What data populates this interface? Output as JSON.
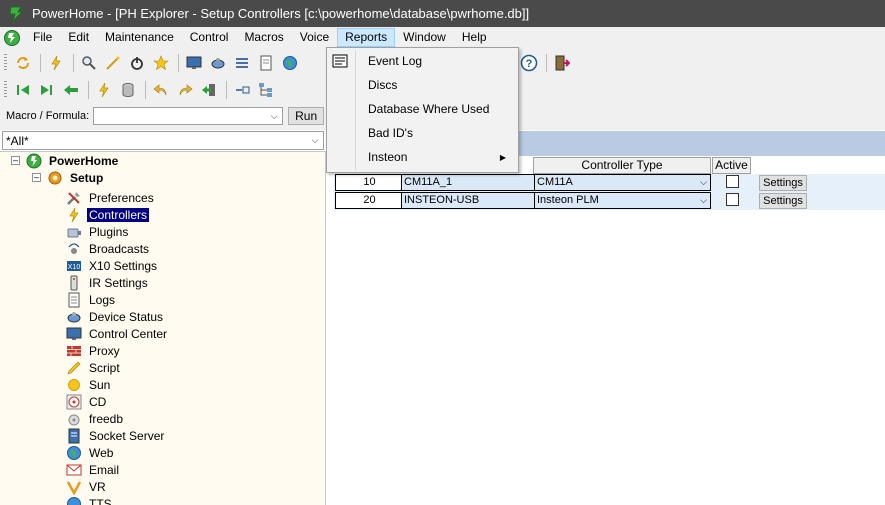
{
  "window": {
    "app_name": "PowerHome",
    "title": "PowerHome - [PH Explorer - Setup Controllers [c:\\powerhome\\database\\pwrhome.db]]"
  },
  "menubar": {
    "items": [
      "File",
      "Edit",
      "Maintenance",
      "Control",
      "Macros",
      "Voice",
      "Reports",
      "Window",
      "Help"
    ],
    "active": "Reports"
  },
  "toolbar": {
    "row1_icons": [
      "refresh-icon",
      "lightning-icon",
      "magnify-icon",
      "wand-icon",
      "power-icon",
      "star-icon",
      "monitor-icon",
      "satellite-icon",
      "list-icon",
      "document-icon",
      "globe-icon"
    ],
    "row2_icons": [
      "first-icon",
      "next-icon",
      "back-icon",
      "flash-icon",
      "database-icon",
      "undo-icon",
      "redo-icon",
      "exit-icon",
      "link-icon",
      "tree-icon"
    ],
    "right_icons": [
      "help-icon",
      "door-icon"
    ]
  },
  "macro": {
    "label": "Macro / Formula:",
    "value": "",
    "run_label": "Run"
  },
  "filter": {
    "value": "*All*"
  },
  "tree": {
    "root": "PowerHome",
    "setup": "Setup",
    "items": [
      {
        "label": "Preferences",
        "icon": "tools-icon"
      },
      {
        "label": "Controllers",
        "icon": "lightning-icon",
        "selected": true
      },
      {
        "label": "Plugins",
        "icon": "plugin-icon"
      },
      {
        "label": "Broadcasts",
        "icon": "broadcast-icon"
      },
      {
        "label": "X10 Settings",
        "icon": "x10-icon"
      },
      {
        "label": "IR Settings",
        "icon": "remote-icon"
      },
      {
        "label": "Logs",
        "icon": "log-icon"
      },
      {
        "label": "Device Status",
        "icon": "device-icon"
      },
      {
        "label": "Control Center",
        "icon": "monitor-icon"
      },
      {
        "label": "Proxy",
        "icon": "brick-icon"
      },
      {
        "label": "Script",
        "icon": "pencil-icon"
      },
      {
        "label": "Sun",
        "icon": "sun-icon"
      },
      {
        "label": "CD",
        "icon": "cd-icon"
      },
      {
        "label": "freedb",
        "icon": "freedb-icon"
      },
      {
        "label": "Socket Server",
        "icon": "server-icon"
      },
      {
        "label": "Web",
        "icon": "globe-icon"
      },
      {
        "label": "Email",
        "icon": "email-icon"
      },
      {
        "label": "VR",
        "icon": "vr-icon"
      },
      {
        "label": "TTS",
        "icon": "tts-icon"
      }
    ]
  },
  "grid": {
    "headers": {
      "controller_type": "Controller Type",
      "active": "Active"
    },
    "rows": [
      {
        "id": "10",
        "name": "CM11A_1",
        "type": "CM11A",
        "active": false,
        "settings": "Settings"
      },
      {
        "id": "20",
        "name": "INSTEON-USB",
        "type": "Insteon PLM",
        "active": false,
        "settings": "Settings"
      }
    ]
  },
  "reports_menu": {
    "items": [
      {
        "label": "Event Log",
        "icon": "eventlog-icon"
      },
      {
        "label": "Discs"
      },
      {
        "label": "Database Where Used"
      },
      {
        "label": "Bad ID's"
      },
      {
        "label": "Insteon",
        "submenu": true
      }
    ]
  },
  "colors": {
    "titlebar": "#4a4a4a",
    "selection": "#000080",
    "tree_bg": "#fffbf0",
    "pane_header": "#b8cbe2",
    "menu_active": "#cce8ff"
  }
}
